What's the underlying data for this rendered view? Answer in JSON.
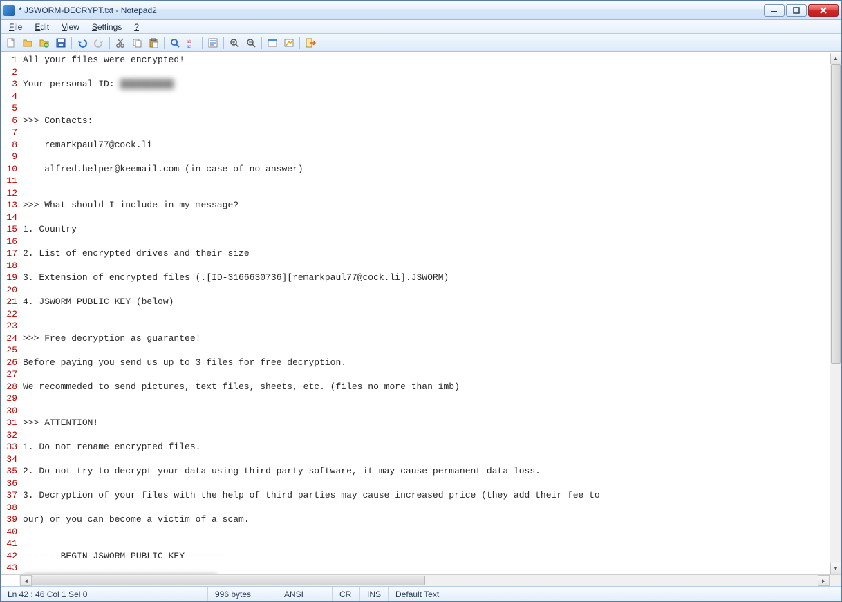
{
  "window": {
    "title": "* JSWORM-DECRYPT.txt - Notepad2"
  },
  "menu": {
    "file": "File",
    "edit": "Edit",
    "view": "View",
    "settings": "Settings",
    "help": "?"
  },
  "toolbar_icons": [
    "new-file-icon",
    "open-file-icon",
    "browse-folder-icon",
    "save-icon",
    "sep",
    "undo-icon",
    "redo-icon",
    "sep",
    "cut-icon",
    "copy-icon",
    "paste-icon",
    "sep",
    "find-icon",
    "replace-icon",
    "sep",
    "word-wrap-icon",
    "sep",
    "zoom-in-icon",
    "zoom-out-icon",
    "sep",
    "scheme-icon",
    "customize-icon",
    "sep",
    "exit-icon"
  ],
  "document": {
    "lines": [
      "All your files were encrypted!",
      "",
      "Your personal ID: ██████████",
      "",
      "",
      ">>> Contacts:",
      "",
      "    remarkpaul77@cock.li",
      "",
      "    alfred.helper@keemail.com (in case of no answer)",
      "",
      "",
      ">>> What should I include in my message?",
      "",
      "1. Country",
      "",
      "2. List of encrypted drives and their size",
      "",
      "3. Extension of encrypted files (.[ID-3166630736][remarkpaul77@cock.li].JSWORM)",
      "",
      "4. JSWORM PUBLIC KEY (below)",
      "",
      "",
      ">>> Free decryption as guarantee!",
      "",
      "Before paying you send us up to 3 files for free decryption.",
      "",
      "We recommeded to send pictures, text files, sheets, etc. (files no more than 1mb)",
      "",
      "",
      ">>> ATTENTION!",
      "",
      "1. Do not rename encrypted files.",
      "",
      "2. Do not try to decrypt your data using third party software, it may cause permanent data loss.",
      "",
      "3. Decryption of your files with the help of third parties may cause increased price (they add their fee to ",
      "",
      "our) or you can become a victim of a scam.",
      "",
      "",
      "-------BEGIN JSWORM PUBLIC KEY-------",
      "",
      "████████████████████████████████████"
    ],
    "blurred_line_indices": [
      2,
      43
    ]
  },
  "status": {
    "position": "Ln 42 : 46   Col 1   Sel 0",
    "size": "996 bytes",
    "encoding": "ANSI",
    "eol": "CR",
    "mode": "INS",
    "scheme": "Default Text"
  }
}
